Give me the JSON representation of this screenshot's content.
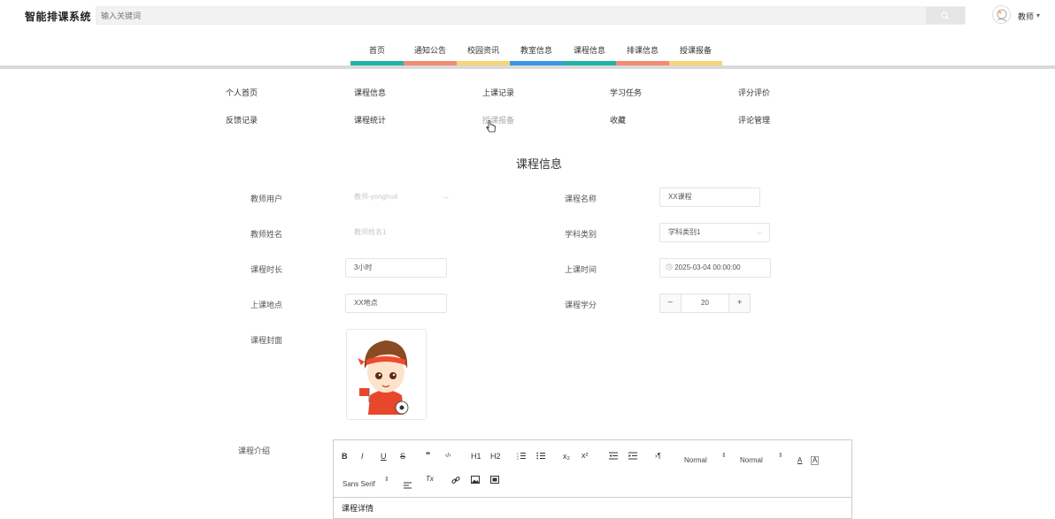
{
  "header": {
    "app_title": "智能排课系统",
    "search_placeholder": "输入关键词",
    "user_name": "教师",
    "user_caret": "▾"
  },
  "nav": {
    "items": [
      {
        "label": "首页",
        "color": "#21b3a6"
      },
      {
        "label": "通知公告",
        "color": "#f58a73"
      },
      {
        "label": "校园资讯",
        "color": "#f9d475"
      },
      {
        "label": "教室信息",
        "color": "#3a94e7"
      },
      {
        "label": "课程信息",
        "color": "#21b3a6"
      },
      {
        "label": "排课信息",
        "color": "#f58a73"
      },
      {
        "label": "授课报备",
        "color": "#f9d475"
      }
    ]
  },
  "subnav": {
    "items": [
      {
        "label": "个人首页"
      },
      {
        "label": "课程信息"
      },
      {
        "label": "上课记录"
      },
      {
        "label": "学习任务"
      },
      {
        "label": "评分评价"
      },
      {
        "label": "反馈记录"
      },
      {
        "label": "课程统计"
      },
      {
        "label": "授课报备"
      },
      {
        "label": "收藏"
      },
      {
        "label": "评论管理"
      }
    ]
  },
  "page": {
    "title": "课程信息"
  },
  "form": {
    "teacher_user": {
      "label": "教师用户",
      "value": "教师-yonghu4"
    },
    "teacher_name": {
      "label": "教师姓名",
      "value": "教师姓名1"
    },
    "duration": {
      "label": "课程时长",
      "value": "3小时"
    },
    "location": {
      "label": "上课地点",
      "value": "XX地点"
    },
    "cover": {
      "label": "课程封面"
    },
    "course_name": {
      "label": "课程名称",
      "value": "XX课程"
    },
    "subject": {
      "label": "学科类别",
      "value": "学科类别1"
    },
    "class_time": {
      "label": "上课时间",
      "value": "2025-03-04 00:00:00"
    },
    "credits": {
      "label": "课程学分",
      "value": "20",
      "minus": "−",
      "plus": "+"
    },
    "intro": {
      "label": "课程介绍"
    }
  },
  "editor": {
    "toolbar": {
      "bold": "B",
      "italic": "I",
      "underline": "U",
      "strike": "S",
      "blockquote": "❞",
      "code": "‹/›",
      "h1": "H1",
      "h2": "H2",
      "subscript": "x₂",
      "superscript": "x²",
      "direction": "›¶",
      "size_select": "Normal",
      "header_select": "Normal",
      "font_select": "Sans Serif",
      "select_arrow": "⇕",
      "clean": "Tx",
      "font_color": "A",
      "bg_color": "A"
    },
    "content": "课程详情"
  },
  "icons": {
    "search": "search-icon",
    "chevron": "chevron-down-icon",
    "clock": "clock-icon",
    "cursor": "hand-pointer-icon"
  }
}
